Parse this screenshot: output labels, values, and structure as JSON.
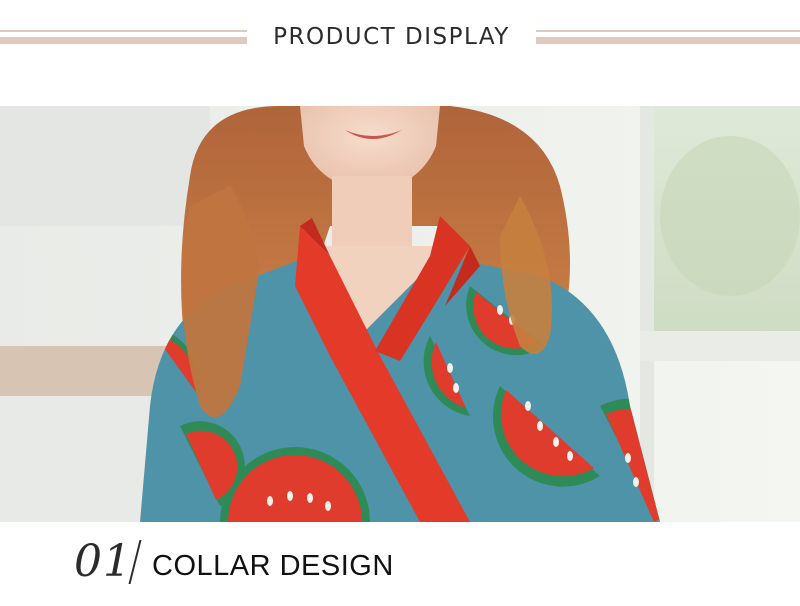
{
  "header": {
    "title": "PRODUCT DISPLAY"
  },
  "section": {
    "number": "01",
    "title": "COLLAR DESIGN"
  },
  "colors": {
    "rule": "#e2c8bd",
    "robe_blue": "#4e93a7",
    "collar_red": "#e33a2a",
    "hair": "#c8783e"
  },
  "photo": {
    "subject": "woman-in-watermelon-print-robe"
  }
}
